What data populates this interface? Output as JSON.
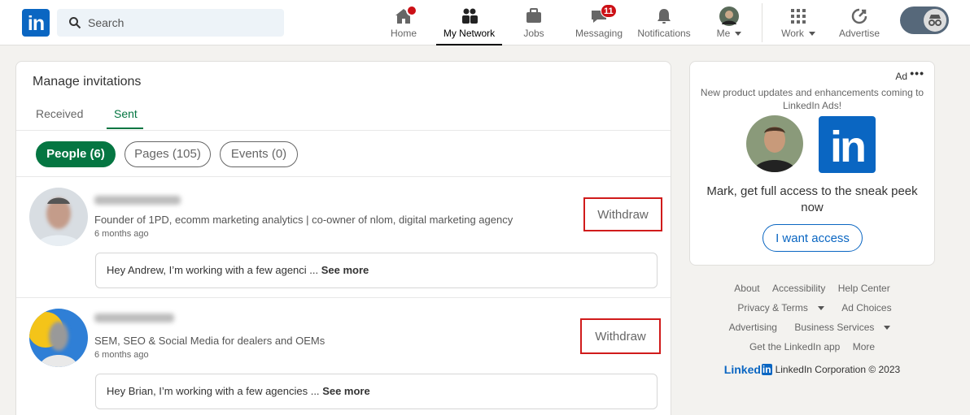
{
  "nav": {
    "logo_text": "in",
    "search_placeholder": "Search",
    "items": [
      {
        "label": "Home"
      },
      {
        "label": "My Network"
      },
      {
        "label": "Jobs"
      },
      {
        "label": "Messaging",
        "badge": "11"
      },
      {
        "label": "Notifications"
      },
      {
        "label": "Me"
      },
      {
        "label": "Work"
      },
      {
        "label": "Advertise"
      }
    ]
  },
  "page": {
    "title": "Manage invitations",
    "tabs": [
      {
        "label": "Received"
      },
      {
        "label": "Sent",
        "active": true
      }
    ],
    "filters": [
      {
        "label": "People (6)",
        "active": true
      },
      {
        "label": "Pages (105)"
      },
      {
        "label": "Events (0)"
      }
    ],
    "invitations": [
      {
        "headline": "Founder of 1PD, ecomm marketing analytics | co-owner of nlom, digital marketing agency",
        "time": "6 months ago",
        "withdraw_label": "Withdraw",
        "message": "Hey Andrew, I’m working with a few agenci ...",
        "see_more": "See more"
      },
      {
        "headline": "SEM, SEO & Social Media for dealers and OEMs",
        "time": "6 months ago",
        "withdraw_label": "Withdraw",
        "message": "Hey Brian, I’m working with a few agencies ...",
        "see_more": "See more"
      }
    ]
  },
  "ad": {
    "label": "Ad",
    "menu": "•••",
    "text": "New product updates and enhancements coming to LinkedIn Ads!",
    "logo_text": "in",
    "cta_text": "Mark, get full access to the sneak peek now",
    "button": "I want access"
  },
  "footer": {
    "row1": [
      "About",
      "Accessibility",
      "Help Center"
    ],
    "row2": [
      "Privacy & Terms",
      "Ad Choices"
    ],
    "row3": [
      "Advertising",
      "Business Services"
    ],
    "row4": [
      "Get the LinkedIn app",
      "More"
    ],
    "brand_word": "Linked",
    "brand_in": "in",
    "copyright": "LinkedIn Corporation © 2023"
  },
  "colors": {
    "brand": "#0a66c2",
    "active_green": "#057642",
    "badge_red": "#cc1016",
    "highlight_red": "#d01b1b"
  }
}
